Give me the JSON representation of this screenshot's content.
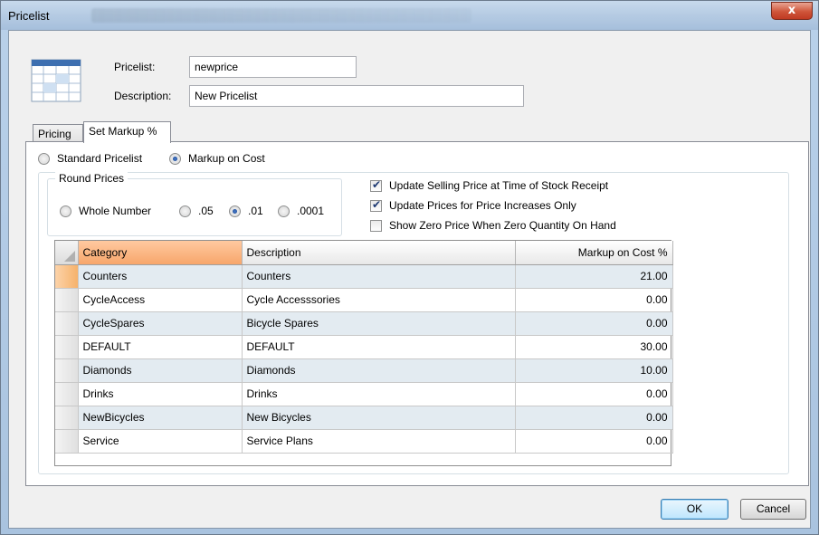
{
  "window": {
    "title": "Pricelist",
    "close_label": "x"
  },
  "header": {
    "pricelist_label": "Pricelist:",
    "pricelist_value": "newprice",
    "description_label": "Description:",
    "description_value": "New Pricelist",
    "icon": "table-grid-icon"
  },
  "tabs": [
    {
      "label": "Pricing",
      "active": false
    },
    {
      "label": "Set Markup %",
      "active": true
    }
  ],
  "pricelist_type": {
    "options": [
      "Standard Pricelist",
      "Markup on Cost"
    ],
    "selected": "Markup on Cost"
  },
  "round_prices": {
    "legend": "Round Prices",
    "options": [
      "Whole Number",
      ".05",
      ".01",
      ".0001"
    ],
    "selected": ".01"
  },
  "options": [
    {
      "label": "Update Selling Price at Time of Stock Receipt",
      "checked": true
    },
    {
      "label": "Update Prices for Price Increases Only",
      "checked": true
    },
    {
      "label": "Show Zero Price When Zero Quantity On Hand",
      "checked": false
    }
  ],
  "grid": {
    "columns": [
      "Category",
      "Description",
      "Markup on Cost %"
    ],
    "rows": [
      {
        "category": "Counters",
        "description": "Counters",
        "markup": "21.00"
      },
      {
        "category": "CycleAccess",
        "description": "Cycle Accesssories",
        "markup": "0.00"
      },
      {
        "category": "CycleSpares",
        "description": "Bicycle Spares",
        "markup": "0.00"
      },
      {
        "category": "DEFAULT",
        "description": "DEFAULT",
        "markup": "30.00"
      },
      {
        "category": "Diamonds",
        "description": "Diamonds",
        "markup": "10.00"
      },
      {
        "category": "Drinks",
        "description": "Drinks",
        "markup": "0.00"
      },
      {
        "category": "NewBicycles",
        "description": "New Bicycles",
        "markup": "0.00"
      },
      {
        "category": "Service",
        "description": "Service Plans",
        "markup": "0.00"
      }
    ]
  },
  "buttons": {
    "ok": "OK",
    "cancel": "Cancel"
  },
  "colors": {
    "sorted_header": "#f7a66b",
    "alt_row": "#e3ebf1",
    "title_bar": "#b5cbe3"
  }
}
